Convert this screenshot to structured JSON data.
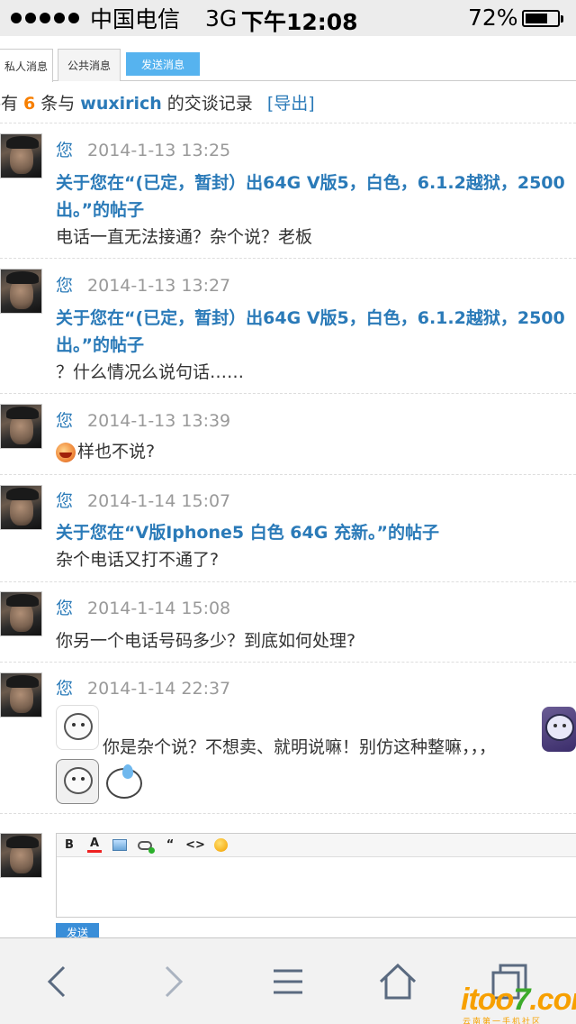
{
  "status_bar": {
    "carrier": "中国电信",
    "network": "3G",
    "time": "下午12:08",
    "battery": "72%"
  },
  "tabs": [
    {
      "label": "私人消息"
    },
    {
      "label": "公共消息"
    },
    {
      "label": "发送消息"
    }
  ],
  "summary": {
    "prefix": "共有",
    "count": "6",
    "middle": "条与",
    "user": "wuxirich",
    "suffix": "的交谈记录",
    "export": "[导出]"
  },
  "messages": [
    {
      "sender": "您",
      "time": "2014-1-13 13:25",
      "subject": "关于您在“(已定，暂封）出64G V版5，白色，6.1.2越狱，2500出。”的帖子",
      "text": "电话一直无法接通？杂个说？老板"
    },
    {
      "sender": "您",
      "time": "2014-1-13 13:27",
      "subject": "关于您在“(已定，暂封）出64G V版5，白色，6.1.2越狱，2500出。”的帖子",
      "text": "？什么情况么说句话……"
    },
    {
      "sender": "您",
      "time": "2014-1-13 13:39",
      "subject": "",
      "text": "样也不说?"
    },
    {
      "sender": "您",
      "time": "2014-1-14 15:07",
      "subject": "关于您在“V版Iphone5 白色 64G 充新。”的帖子",
      "text": "杂个电话又打不通了?"
    },
    {
      "sender": "您",
      "time": "2014-1-14 15:08",
      "subject": "",
      "text": "你另一个电话号码多少？到底如何处理?"
    },
    {
      "sender": "您",
      "time": "2014-1-14 22:37",
      "subject": "",
      "text": "你是杂个说？不想卖、就明说嘛！别仿这种整嘛，，，"
    }
  ],
  "editor": {
    "toolbar": {
      "bold": "B",
      "color": "A",
      "quote": "“",
      "code": "<>"
    },
    "value": "",
    "send_label": "发送"
  },
  "watermark": {
    "text_a": "itoo",
    "text_b": "7",
    "text_c": ".com",
    "sub": "云南第一手机社区"
  },
  "icons": [
    "back-arrow-icon",
    "forward-arrow-icon",
    "menu-icon",
    "home-icon",
    "tabs-icon"
  ]
}
